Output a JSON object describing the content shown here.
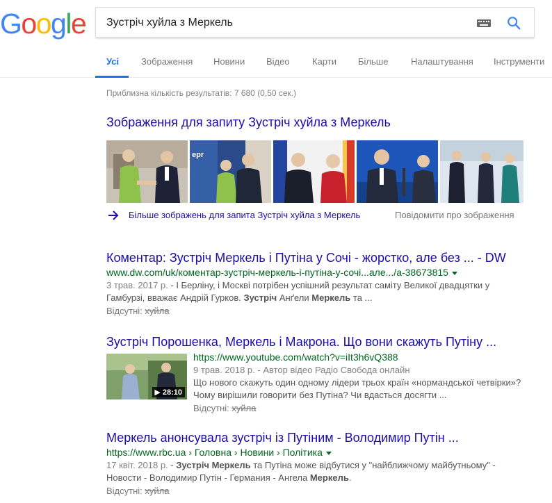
{
  "logo": {
    "text": "Google"
  },
  "search": {
    "query": "Зустріч хуйла з Меркель"
  },
  "tabs": [
    {
      "label": "Усі"
    },
    {
      "label": "Зображення"
    },
    {
      "label": "Новини"
    },
    {
      "label": "Відео"
    },
    {
      "label": "Карти"
    },
    {
      "label": "Більше"
    },
    {
      "label": "Налаштування"
    },
    {
      "label": "Інструменти"
    }
  ],
  "stats": "Приблизна кількість результатів: 7 680 (0,50 сек.)",
  "images_block": {
    "heading": "Зображення для запиту Зустріч хуйла з Меркель",
    "more_label": "Більше зображень для запита Зустріч хуйла з Меркель",
    "report_label": "Повідомити про зображення"
  },
  "results": [
    {
      "title": "Коментар: Зустріч Меркель і Путіна у Сочі - жорстко, але без ... - DW",
      "url": "www.dw.com/uk/коментар-зустріч-меркель-і-путіна-у-сочі...але.../a-38673815",
      "date": "3 трав. 2017 р.",
      "snippet_line1": " - І Берліну, і Москві потрібен успішний результат саміту Великої двадцятки у",
      "snippet_line2_a": "Гамбурзі, вважає Андрій Гурков. ",
      "snippet_bold1": "Зустріч",
      "snippet_line2_b": " Анґели ",
      "snippet_bold2": "Меркель",
      "snippet_line2_c": " та ...",
      "missing_label": "Відсутні:",
      "missing_word": "хуйла"
    },
    {
      "title": "Зустріч Порошенка, Меркель і Макрона. Що вони скажуть Путіну ...",
      "url": "https://www.youtube.com/watch?v=iIt3h6vQ388",
      "date": "9 трав. 2018 р.",
      "meta": " - Автор відео Радіо Свобода онлайн",
      "snippet_line1": "Що нового скажуть один одному лідери трьох країн «нормандської четвірки»?",
      "snippet_line2": "Чому вирішили говорити без Путіна? Чи вдасться досягти ...",
      "duration": "▶ 28:10",
      "missing_label": "Відсутні:",
      "missing_word": "хуйла"
    },
    {
      "title": "Меркель анонсувала зустріч із Путіним - Володимир Путін ...",
      "url": "https://www.rbc.ua › Головна › Новини › Політика",
      "date": "17 квіт. 2018 р.",
      "snippet_a": " - ",
      "snippet_bold1": "Зустріч Меркель",
      "snippet_b": " та Путіна може відбутися у \"найближчому майбутньому\" -",
      "snippet_line2_a": "Новости - Володимир Путін - Германия - Ангела ",
      "snippet_bold2": "Меркель",
      "snippet_line2_b": ".",
      "missing_label": "Відсутні:",
      "missing_word": "хуйла"
    }
  ],
  "colors": {
    "link": "#1a0dab",
    "url": "#006621",
    "active_tab": "#1a73e8",
    "snippet": "#545454"
  }
}
